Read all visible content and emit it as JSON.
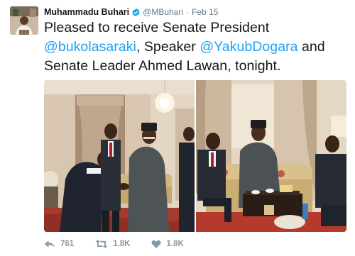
{
  "tweet": {
    "author_name": "Muhammadu Buhari",
    "handle": "@MBuhari",
    "separator": "·",
    "time": "Feb 15",
    "text_part_1": "Pleased to receive Senate President ",
    "mention_1": "@bukolasaraki",
    "text_part_2": ", Speaker ",
    "mention_2": "@YakubDogara",
    "text_part_3": " and Senate Leader Ahmed Lawan, tonight."
  },
  "actions": {
    "reply_count": "761",
    "retweet_count": "1.8K",
    "like_count": "1.8K"
  },
  "colors": {
    "link": "#1da1f2",
    "muted": "#657786",
    "action": "#8899a6",
    "verified": "#1da1f2"
  },
  "icons": {
    "verified": "verified-badge-icon",
    "reply": "reply-icon",
    "retweet": "retweet-icon",
    "like": "heart-icon"
  }
}
